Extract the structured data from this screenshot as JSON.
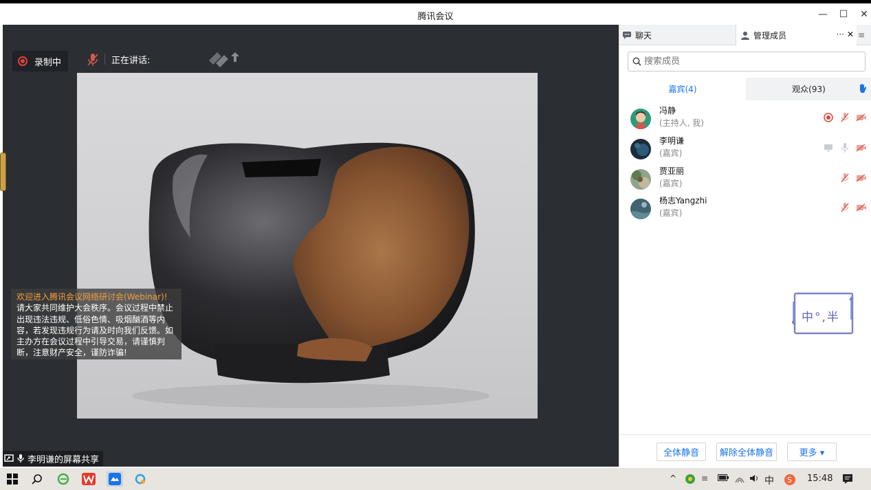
{
  "window": {
    "title": "腾讯会议",
    "minimize": "—",
    "maximize": "☐",
    "close": "✕"
  },
  "stage": {
    "recording_label": "录制中",
    "speaking_label": "正在讲话:",
    "welcome": {
      "line1": "欢迎进入腾讯会议网络研讨会(Webinar)!",
      "body": "请大家共同维护大会秩序。会议过程中禁止出现违法违规、低俗色情、吸烟酗酒等内容，若发现违规行为请及时向我们反馈。如主办方在会议过程中引导交易，请谨慎判断，注意财产安全，谨防诈骗!"
    },
    "share_label": "李明谦的屏幕共享"
  },
  "panel": {
    "tab_chat": "聊天",
    "tab_members": "管理成员",
    "tab_more": "···",
    "tab_close": "✕",
    "menu": "≡",
    "search_placeholder": "搜索成员",
    "subtab_guests": "嘉宾(4)",
    "subtab_audience": "观众(93)",
    "members": [
      {
        "name": "冯静",
        "role": "(主持人, 我)"
      },
      {
        "name": "李明谦",
        "role": "(嘉宾)"
      },
      {
        "name": "贾亚丽",
        "role": "(嘉宾)"
      },
      {
        "name": "杨志Yangzhi",
        "role": "(嘉宾)"
      }
    ],
    "buttons": {
      "mute_all": "全体静音",
      "unmute_all": "解除全体静音",
      "more": "更多 ▾"
    },
    "ime_text": "中°,半"
  },
  "taskbar": {
    "time": "15:48",
    "ime_indicator": "中",
    "colors": {
      "accent": "#1a73e8",
      "record": "#e3413c"
    }
  }
}
